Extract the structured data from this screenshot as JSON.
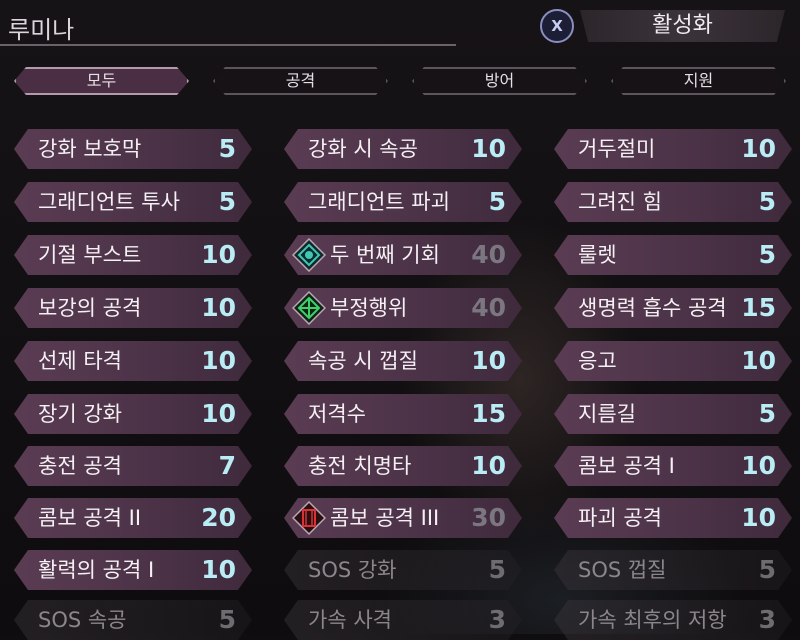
{
  "title": "루미나",
  "activate": {
    "button_glyph": "X",
    "label": "활성화"
  },
  "filters": [
    "모두",
    "공격",
    "방어",
    "지원"
  ],
  "skills": [
    {
      "name": "강화 보호막",
      "cost": "5"
    },
    {
      "name": "강화 시 속공",
      "cost": "10"
    },
    {
      "name": "거두절미",
      "cost": "10"
    },
    {
      "name": "그래디언트 투사",
      "cost": "5"
    },
    {
      "name": "그래디언트 파괴",
      "cost": "5"
    },
    {
      "name": "그려진 힘",
      "cost": "5"
    },
    {
      "name": "기절 부스트",
      "cost": "10"
    },
    {
      "name": "두 번째 기회",
      "cost": "40",
      "icon": "teal-diamond-icon"
    },
    {
      "name": "룰렛",
      "cost": "5"
    },
    {
      "name": "보강의 공격",
      "cost": "10"
    },
    {
      "name": "부정행위",
      "cost": "40",
      "icon": "green-diamond-icon"
    },
    {
      "name": "생명력 흡수 공격",
      "cost": "15"
    },
    {
      "name": "선제 타격",
      "cost": "10"
    },
    {
      "name": "속공 시 껍질",
      "cost": "10"
    },
    {
      "name": "응고",
      "cost": "10"
    },
    {
      "name": "장기 강화",
      "cost": "10"
    },
    {
      "name": "저격수",
      "cost": "15"
    },
    {
      "name": "지름길",
      "cost": "5"
    },
    {
      "name": "충전 공격",
      "cost": "7"
    },
    {
      "name": "충전 치명타",
      "cost": "10"
    },
    {
      "name": "콤보 공격 I",
      "cost": "10"
    },
    {
      "name": "콤보 공격 II",
      "cost": "20"
    },
    {
      "name": "콤보 공격 III",
      "cost": "30",
      "icon": "red-diamond-icon"
    },
    {
      "name": "파괴 공격",
      "cost": "10"
    },
    {
      "name": "활력의 공격 I",
      "cost": "10"
    },
    {
      "name": "SOS 강화",
      "cost": "5"
    },
    {
      "name": "SOS 껍질",
      "cost": "5"
    },
    {
      "name": "SOS 속공",
      "cost": "5"
    },
    {
      "name": "가속 사격",
      "cost": "3"
    },
    {
      "name": "가속 최후의 저항",
      "cost": "3"
    }
  ],
  "colors": {
    "accent": "#b9ecf5",
    "tile": "#5a3c53",
    "active_filter": "#4a2f44"
  }
}
